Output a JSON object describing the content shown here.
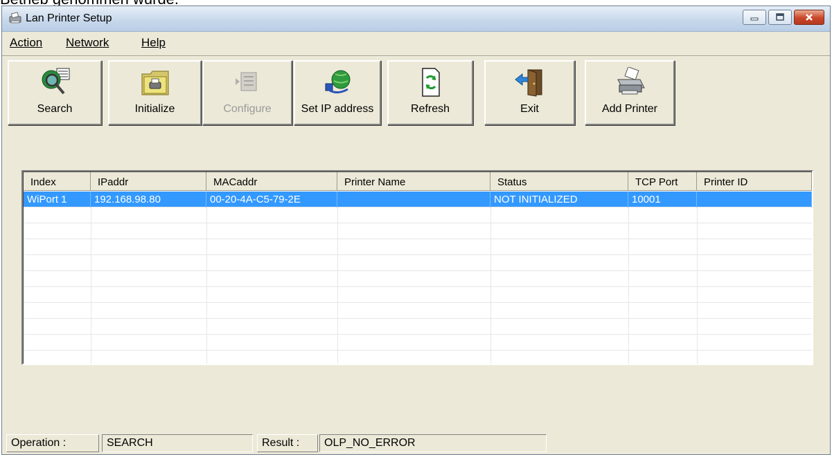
{
  "background_text": "Betrieb genommen wurde.",
  "window": {
    "title": "Lan Printer Setup",
    "icon": "printer-icon",
    "controls": {
      "minimize": "minimize-icon",
      "maximize": "maximize-icon",
      "close": "close-icon"
    }
  },
  "menu": [
    {
      "label": "Action"
    },
    {
      "label": "Network"
    },
    {
      "label": "Help"
    }
  ],
  "toolbar": [
    {
      "label": "Search",
      "icon": "search-globe-icon",
      "enabled": true
    },
    {
      "label": "Initialize",
      "icon": "printer-folder-icon",
      "enabled": true
    },
    {
      "label": "Configure",
      "icon": "configure-icon",
      "enabled": false
    },
    {
      "label": "Set IP address",
      "icon": "network-globe-icon",
      "enabled": true
    },
    {
      "label": "Refresh",
      "icon": "refresh-icon",
      "enabled": true
    },
    {
      "label": "Exit",
      "icon": "exit-door-icon",
      "enabled": true
    },
    {
      "label": "Add Printer",
      "icon": "add-printer-icon",
      "enabled": true
    }
  ],
  "table": {
    "columns": [
      "Index",
      "IPaddr",
      "MACaddr",
      "Printer Name",
      "Status",
      "TCP Port",
      "Printer ID"
    ],
    "rows": [
      {
        "selected": true,
        "cells": [
          "WiPort 1",
          "192.168.98.80",
          "00-20-4A-C5-79-2E",
          "",
          "NOT INITIALIZED",
          "10001",
          ""
        ]
      }
    ],
    "colors": {
      "selection": "#3399ff"
    }
  },
  "status": {
    "operation_label": "Operation :",
    "operation_value": "SEARCH",
    "result_label": "Result :",
    "result_value": "OLP_NO_ERROR"
  }
}
